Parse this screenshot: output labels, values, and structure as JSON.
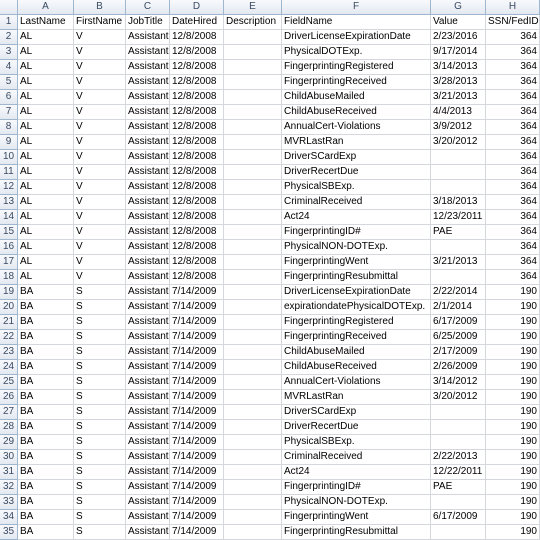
{
  "column_letters": [
    "A",
    "B",
    "C",
    "D",
    "E",
    "F",
    "G",
    "H"
  ],
  "rows": [
    {
      "num": "1",
      "cells": [
        "LastName",
        "FirstName",
        "JobTitle",
        "DateHired",
        "Description",
        "FieldName",
        "Value",
        "SSN/FedID"
      ]
    },
    {
      "num": "2",
      "cells": [
        "AL",
        "V",
        "Assistant",
        "12/8/2008",
        "",
        "DriverLicenseExpirationDate",
        "2/23/2016",
        "364"
      ]
    },
    {
      "num": "3",
      "cells": [
        "AL",
        "V",
        "Assistant",
        "12/8/2008",
        "",
        "PhysicalDOTExp.",
        "9/17/2014",
        "364"
      ]
    },
    {
      "num": "4",
      "cells": [
        "AL",
        "V",
        "Assistant",
        "12/8/2008",
        "",
        "FingerprintingRegistered",
        "3/14/2013",
        "364"
      ]
    },
    {
      "num": "5",
      "cells": [
        "AL",
        "V",
        "Assistant",
        "12/8/2008",
        "",
        "FingerprintingReceived",
        "3/28/2013",
        "364"
      ]
    },
    {
      "num": "6",
      "cells": [
        "AL",
        "V",
        "Assistant",
        "12/8/2008",
        "",
        "ChildAbuseMailed",
        "3/21/2013",
        "364"
      ]
    },
    {
      "num": "7",
      "cells": [
        "AL",
        "V",
        "Assistant",
        "12/8/2008",
        "",
        "ChildAbuseReceived",
        "4/4/2013",
        "364"
      ]
    },
    {
      "num": "8",
      "cells": [
        "AL",
        "V",
        "Assistant",
        "12/8/2008",
        "",
        "AnnualCert-Violations",
        "3/9/2012",
        "364"
      ]
    },
    {
      "num": "9",
      "cells": [
        "AL",
        "V",
        "Assistant",
        "12/8/2008",
        "",
        "MVRLastRan",
        "3/20/2012",
        "364"
      ]
    },
    {
      "num": "10",
      "cells": [
        "AL",
        "V",
        "Assistant",
        "12/8/2008",
        "",
        "DriverSCardExp",
        "",
        "364"
      ]
    },
    {
      "num": "11",
      "cells": [
        "AL",
        "V",
        "Assistant",
        "12/8/2008",
        "",
        "DriverRecertDue",
        "",
        "364"
      ]
    },
    {
      "num": "12",
      "cells": [
        "AL",
        "V",
        "Assistant",
        "12/8/2008",
        "",
        "PhysicalSBExp.",
        "",
        "364"
      ]
    },
    {
      "num": "13",
      "cells": [
        "AL",
        "V",
        "Assistant",
        "12/8/2008",
        "",
        "CriminalReceived",
        "3/18/2013",
        "364"
      ]
    },
    {
      "num": "14",
      "cells": [
        "AL",
        "V",
        "Assistant",
        "12/8/2008",
        "",
        "Act24",
        "12/23/2011",
        "364"
      ]
    },
    {
      "num": "15",
      "cells": [
        "AL",
        "V",
        "Assistant",
        "12/8/2008",
        "",
        "FingerprintingID#",
        "PAE",
        "364"
      ]
    },
    {
      "num": "16",
      "cells": [
        "AL",
        "V",
        "Assistant",
        "12/8/2008",
        "",
        "PhysicalNON-DOTExp.",
        "",
        "364"
      ]
    },
    {
      "num": "17",
      "cells": [
        "AL",
        "V",
        "Assistant",
        "12/8/2008",
        "",
        "FingerprintingWent",
        "3/21/2013",
        "364"
      ]
    },
    {
      "num": "18",
      "cells": [
        "AL",
        "V",
        "Assistant",
        "12/8/2008",
        "",
        "FingerprintingResubmittal",
        "",
        "364"
      ]
    },
    {
      "num": "19",
      "cells": [
        "BA",
        "S",
        "Assistant",
        "7/14/2009",
        "",
        "DriverLicenseExpirationDate",
        "2/22/2014",
        "190"
      ]
    },
    {
      "num": "20",
      "cells": [
        "BA",
        "S",
        "Assistant",
        "7/14/2009",
        "",
        "expirationdatePhysicalDOTExp.",
        "2/1/2014",
        "190"
      ]
    },
    {
      "num": "21",
      "cells": [
        "BA",
        "S",
        "Assistant",
        "7/14/2009",
        "",
        "FingerprintingRegistered",
        "6/17/2009",
        "190"
      ]
    },
    {
      "num": "22",
      "cells": [
        "BA",
        "S",
        "Assistant",
        "7/14/2009",
        "",
        "FingerprintingReceived",
        "6/25/2009",
        "190"
      ]
    },
    {
      "num": "23",
      "cells": [
        "BA",
        "S",
        "Assistant",
        "7/14/2009",
        "",
        "ChildAbuseMailed",
        "2/17/2009",
        "190"
      ]
    },
    {
      "num": "24",
      "cells": [
        "BA",
        "S",
        "Assistant",
        "7/14/2009",
        "",
        "ChildAbuseReceived",
        "2/26/2009",
        "190"
      ]
    },
    {
      "num": "25",
      "cells": [
        "BA",
        "S",
        "Assistant",
        "7/14/2009",
        "",
        "AnnualCert-Violations",
        "3/14/2012",
        "190"
      ]
    },
    {
      "num": "26",
      "cells": [
        "BA",
        "S",
        "Assistant",
        "7/14/2009",
        "",
        "MVRLastRan",
        "3/20/2012",
        "190"
      ]
    },
    {
      "num": "27",
      "cells": [
        "BA",
        "S",
        "Assistant",
        "7/14/2009",
        "",
        "DriverSCardExp",
        "",
        "190"
      ]
    },
    {
      "num": "28",
      "cells": [
        "BA",
        "S",
        "Assistant",
        "7/14/2009",
        "",
        "DriverRecertDue",
        "",
        "190"
      ]
    },
    {
      "num": "29",
      "cells": [
        "BA",
        "S",
        "Assistant",
        "7/14/2009",
        "",
        "PhysicalSBExp.",
        "",
        "190"
      ]
    },
    {
      "num": "30",
      "cells": [
        "BA",
        "S",
        "Assistant",
        "7/14/2009",
        "",
        "CriminalReceived",
        "2/22/2013",
        "190"
      ]
    },
    {
      "num": "31",
      "cells": [
        "BA",
        "S",
        "Assistant",
        "7/14/2009",
        "",
        "Act24",
        "12/22/2011",
        "190"
      ]
    },
    {
      "num": "32",
      "cells": [
        "BA",
        "S",
        "Assistant",
        "7/14/2009",
        "",
        "FingerprintingID#",
        "PAE",
        "190"
      ]
    },
    {
      "num": "33",
      "cells": [
        "BA",
        "S",
        "Assistant",
        "7/14/2009",
        "",
        "PhysicalNON-DOTExp.",
        "",
        "190"
      ]
    },
    {
      "num": "34",
      "cells": [
        "BA",
        "S",
        "Assistant",
        "7/14/2009",
        "",
        "FingerprintingWent",
        "6/17/2009",
        "190"
      ]
    },
    {
      "num": "35",
      "cells": [
        "BA",
        "S",
        "Assistant",
        "7/14/2009",
        "",
        "FingerprintingResubmittal",
        "",
        "190"
      ]
    }
  ]
}
